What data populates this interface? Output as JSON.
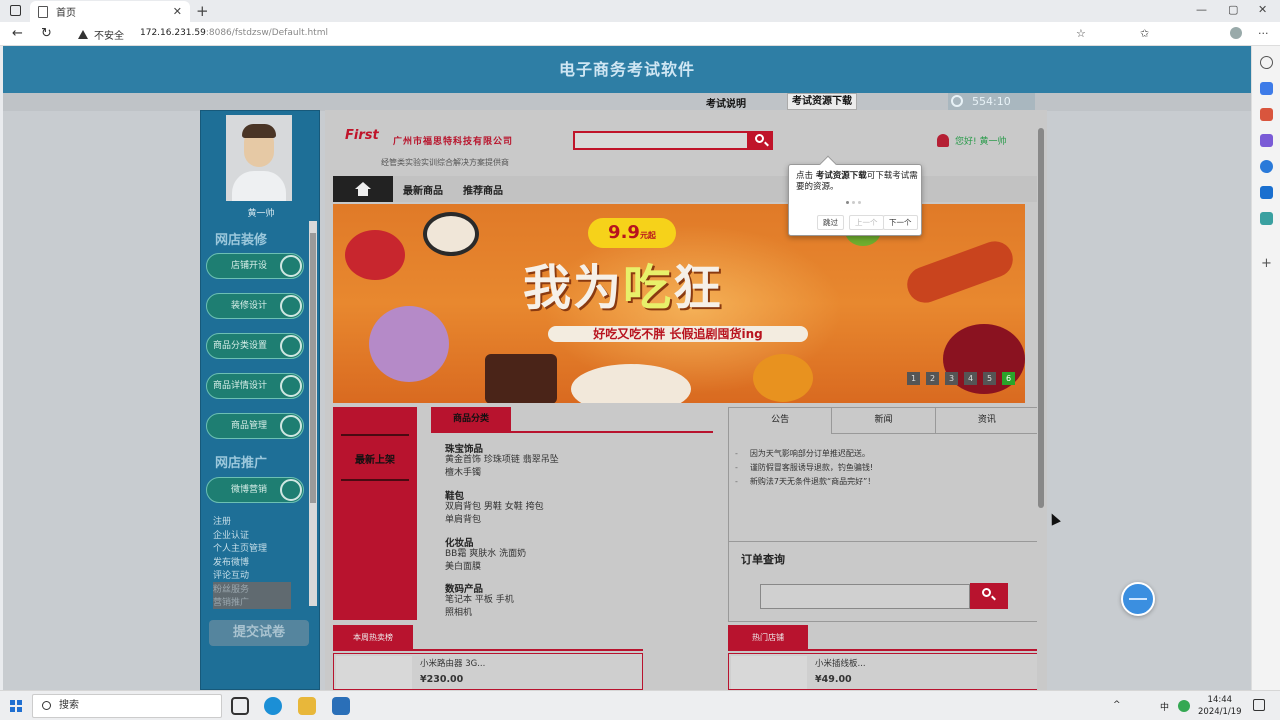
{
  "browser": {
    "tab_title": "首页",
    "tab_close": "✕",
    "new_tab": "+",
    "insecure_label": "不安全",
    "url_host": "172.16.231.59",
    "url_rest": ":8086/fstdzsw/Default.html",
    "win_min": "—",
    "win_max": "▢",
    "win_close": "✕",
    "back": "←",
    "reload": "↻",
    "more": "···"
  },
  "exam": {
    "title": "电子商务考试软件",
    "desc_label": "考试说明",
    "download_label": "考试资源下载",
    "timer": "554:10",
    "user_name": "黄一帅",
    "section_decorate": "网店装修",
    "section_promote": "网店推广",
    "decorate_buttons": [
      "店铺开设",
      "装修设计",
      "商品分类设置",
      "商品详情设计",
      "商品管理"
    ],
    "promote_button": "微博营销",
    "promote_links": [
      "注册",
      "企业认证",
      "个人主页管理",
      "发布微博",
      "评论互动",
      "粉丝服务",
      "营销推广"
    ],
    "submit_label": "提交试卷"
  },
  "store": {
    "logo": "First",
    "company": "广州市福思特科技有限公司",
    "slogan": "经管类实验实训综合解决方案提供商",
    "greeting": "您好! 黄一帅",
    "nav": [
      "最新商品",
      "推荐商品"
    ],
    "banner": {
      "price": "9.9",
      "price_unit": "元起",
      "headline_a": "我为",
      "headline_b": "吃",
      "headline_c": "狂",
      "subline": "好吃又吃不胖 长假追剧囤货ing",
      "slides": [
        "1",
        "2",
        "3",
        "4",
        "5",
        "6"
      ],
      "active_slide": 6
    },
    "new_arrivals": "最新上架",
    "category_tab": "商品分类",
    "categories": [
      {
        "title": "珠宝饰品",
        "items": [
          "黄金首饰  珍珠项链  翡翠吊坠",
          "檀木手镯"
        ]
      },
      {
        "title": "鞋包",
        "items": [
          "双肩背包  男鞋  女鞋  挎包",
          "单肩背包"
        ]
      },
      {
        "title": "化妆品",
        "items": [
          "BB霜  爽肤水  洗面奶",
          "美白面膜"
        ]
      },
      {
        "title": "数码产品",
        "items": [
          "笔记本  平板  手机",
          "照相机"
        ]
      }
    ],
    "news_tabs": [
      "公告",
      "新闻",
      "资讯"
    ],
    "news_items": [
      "因为天气影响部分订单推迟配送。",
      "谨防假冒客服诱导退款，钓鱼骗钱!",
      "新购法7天无条件退款“商品完好”！"
    ],
    "order_title": "订单查询",
    "hot_week_tab": "本周热卖榜",
    "hot_shop_tab": "热门店铺",
    "products": [
      {
        "name": "小米路由器 3G...",
        "price": "¥230.00"
      },
      {
        "name": "小米插线板...",
        "price": "¥49.00"
      }
    ]
  },
  "tour": {
    "text_pre": "点击 ",
    "text_bold": "考试资源下载",
    "text_post": "可下载考试需要的资源。",
    "skip": "跳过",
    "prev": "上一个",
    "next": "下一个"
  },
  "taskbar": {
    "search": "搜索",
    "ime": "中",
    "time": "14:44",
    "date": "2024/1/19"
  }
}
